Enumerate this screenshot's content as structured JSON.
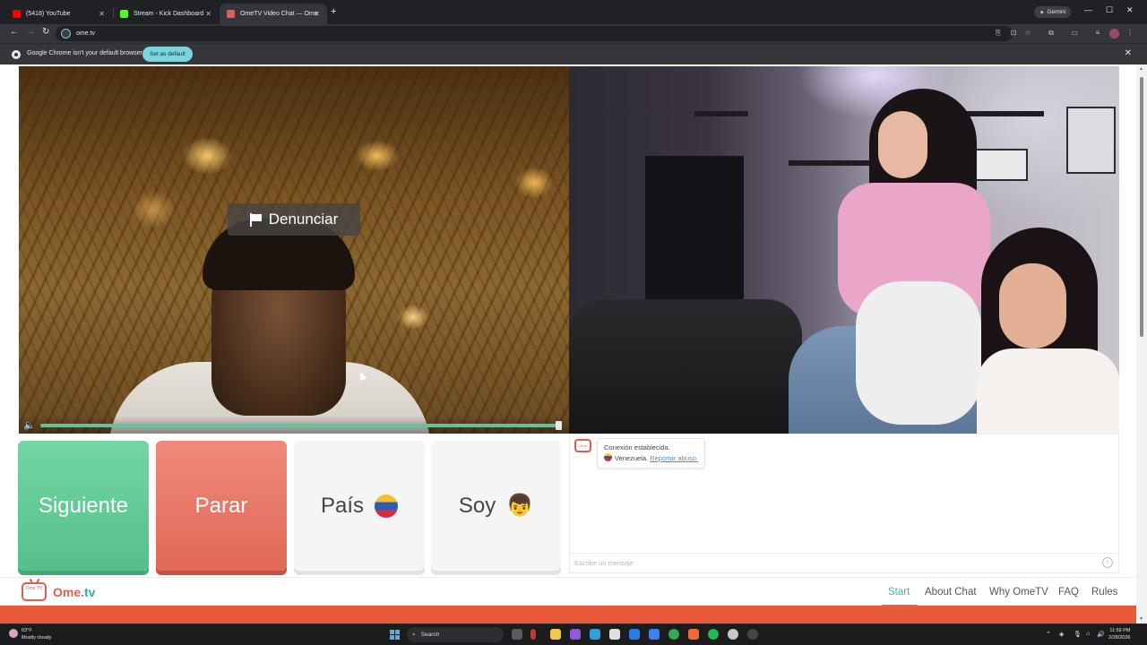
{
  "browser": {
    "tabs": [
      {
        "title": "(5418) YouTube",
        "color": "#ff0000"
      },
      {
        "title": "Stream - Kick Dashboard",
        "color": "#53fc18"
      },
      {
        "title": "OmeTV Video Chat — Ome",
        "color": "#e85a4f"
      }
    ],
    "gemini_label": "Gemini",
    "url": "ome.tv",
    "infobar": {
      "message": "Google Chrome isn't your default browser",
      "button": "Set as default"
    }
  },
  "video": {
    "report_button": "Denunciar",
    "volume_level": 1.0,
    "stranger_country_icon": "venezuela-flag"
  },
  "actions": {
    "next": "Siguiente",
    "stop": "Parar",
    "country": "País",
    "gender": "Soy",
    "gender_icon": "boy-emoji",
    "colors": {
      "next": "#5cc793",
      "stop": "#e8705f"
    }
  },
  "chat": {
    "status": "Conexión establecida.",
    "country": "Venezuela.",
    "report_link": "Reportar abuso.",
    "input_placeholder": "Escribe un mensaje"
  },
  "site": {
    "logo_tv": "Ome TV",
    "logo_ome": "Ome",
    "logo_tv_suffix": ".tv",
    "menu": [
      "Start",
      "About Chat",
      "Why OmeTV",
      "FAQ",
      "Rules"
    ],
    "active_menu": "Start",
    "brand_color": "#e85a4f",
    "accent_color": "#3cb99a"
  },
  "taskbar": {
    "weather_temp": "63°F",
    "weather_text": "Mostly cloudy",
    "search": "Search",
    "time": "11:59 PM",
    "date": "2/28/2026"
  }
}
